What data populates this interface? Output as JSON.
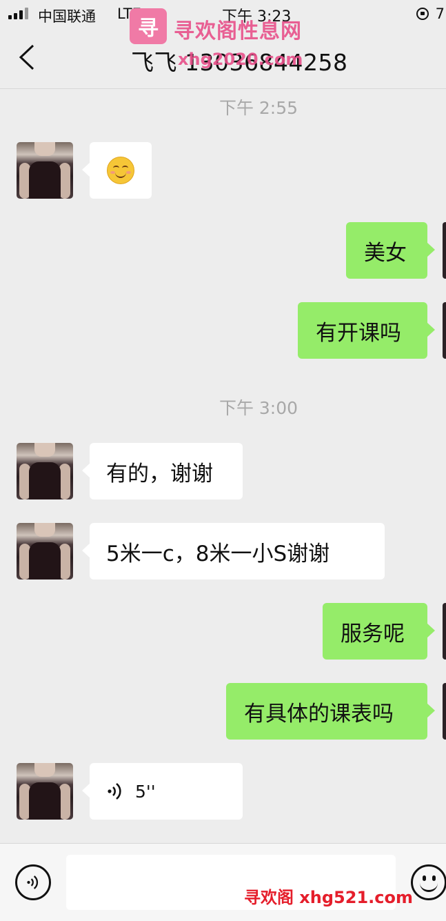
{
  "status_bar": {
    "carrier": "中国联通",
    "network": "LTE",
    "time": "下午 3:23",
    "battery": "7"
  },
  "header": {
    "title": "飞飞 13036844258"
  },
  "watermark": {
    "site_name": "寻欢阁性息网",
    "url": "xhg2020.com",
    "bottom_text": "寻欢阁 xhg521.com",
    "logo_text": "寻欢"
  },
  "messages": [
    {
      "type": "timestamp",
      "text": "下午 2:55"
    },
    {
      "type": "received",
      "kind": "emoji",
      "icon": "smiling-face-emoji"
    },
    {
      "type": "sent",
      "text": "美女"
    },
    {
      "type": "sent",
      "text": "有开课吗"
    },
    {
      "type": "timestamp",
      "text": "下午 3:00"
    },
    {
      "type": "received",
      "text": "有的，谢谢"
    },
    {
      "type": "received",
      "text": "5米一c，8米一小S谢谢"
    },
    {
      "type": "sent",
      "text": "服务呢"
    },
    {
      "type": "sent",
      "text": "有具体的课表吗"
    },
    {
      "type": "received",
      "kind": "voice",
      "duration": "5''"
    }
  ],
  "input_bar": {
    "placeholder": "",
    "voice_toggle_icon": "voice-mode-icon",
    "emoji_icon": "emoji-icon"
  },
  "colors": {
    "background": "#ededed",
    "sent_bubble": "#95ec69",
    "received_bubble": "#ffffff",
    "watermark": "#e8508a"
  }
}
